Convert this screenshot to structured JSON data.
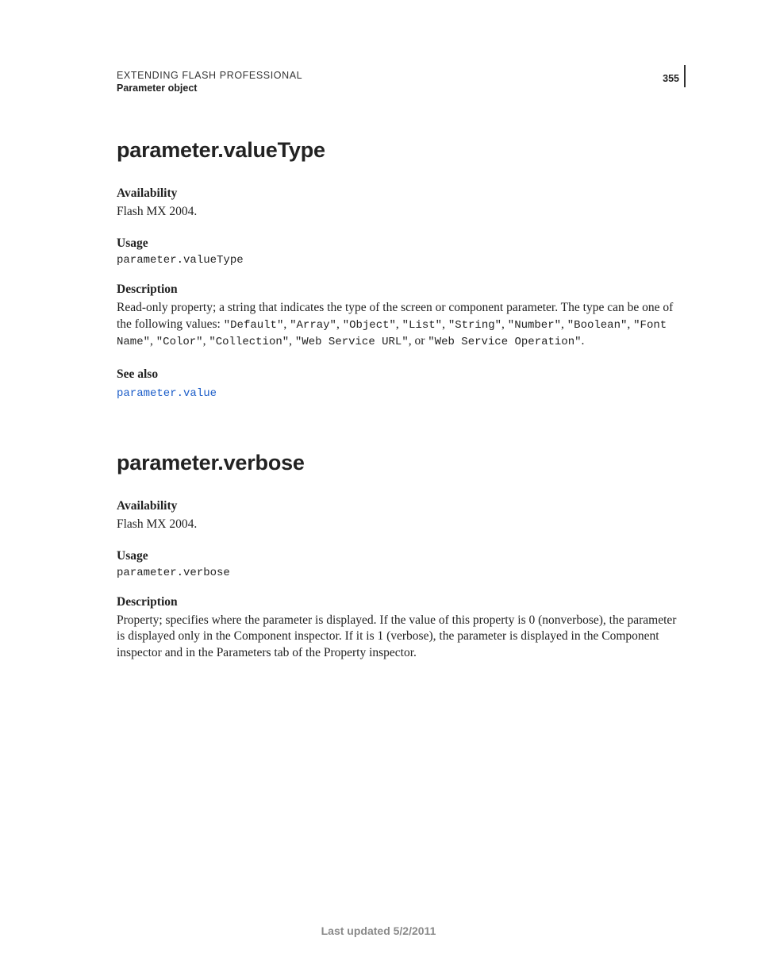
{
  "header": {
    "title": "EXTENDING FLASH PROFESSIONAL",
    "subtitle": "Parameter object",
    "page_number": "355"
  },
  "sections": [
    {
      "heading": "parameter.valueType",
      "availability_label": "Availability",
      "availability_text": "Flash MX 2004.",
      "usage_label": "Usage",
      "usage_code": "parameter.valueType",
      "description_label": "Description",
      "description_pre": "Read-only property; a string that indicates the type of the screen or component parameter. The type can be one of the following values: ",
      "description_codes_1": "\"Default\"",
      "c_sep": ", ",
      "description_codes_2": "\"Array\"",
      "description_codes_3": "\"Object\"",
      "description_codes_4": "\"List\"",
      "description_codes_5": "\"String\"",
      "description_codes_6": "\"Number\"",
      "description_codes_7": "\"Boolean\"",
      "description_codes_8": "\"Font Name\"",
      "description_codes_9": "\"Color\"",
      "description_codes_10": "\"Collection\"",
      "description_codes_11": "\"Web Service URL\"",
      "c_or": ", or ",
      "description_codes_12": "\"Web Service Operation\"",
      "c_end": ".",
      "see_also_label": "See also",
      "see_also_link": "parameter.value"
    },
    {
      "heading": "parameter.verbose",
      "availability_label": "Availability",
      "availability_text": "Flash MX 2004.",
      "usage_label": "Usage",
      "usage_code": "parameter.verbose",
      "description_label": "Description",
      "description_text": "Property; specifies where the parameter is displayed. If the value of this property is 0 (nonverbose), the parameter is displayed only in the Component inspector. If it is 1 (verbose), the parameter is displayed in the Component inspector and in the Parameters tab of the Property inspector."
    }
  ],
  "footer": {
    "updated": "Last updated 5/2/2011"
  }
}
